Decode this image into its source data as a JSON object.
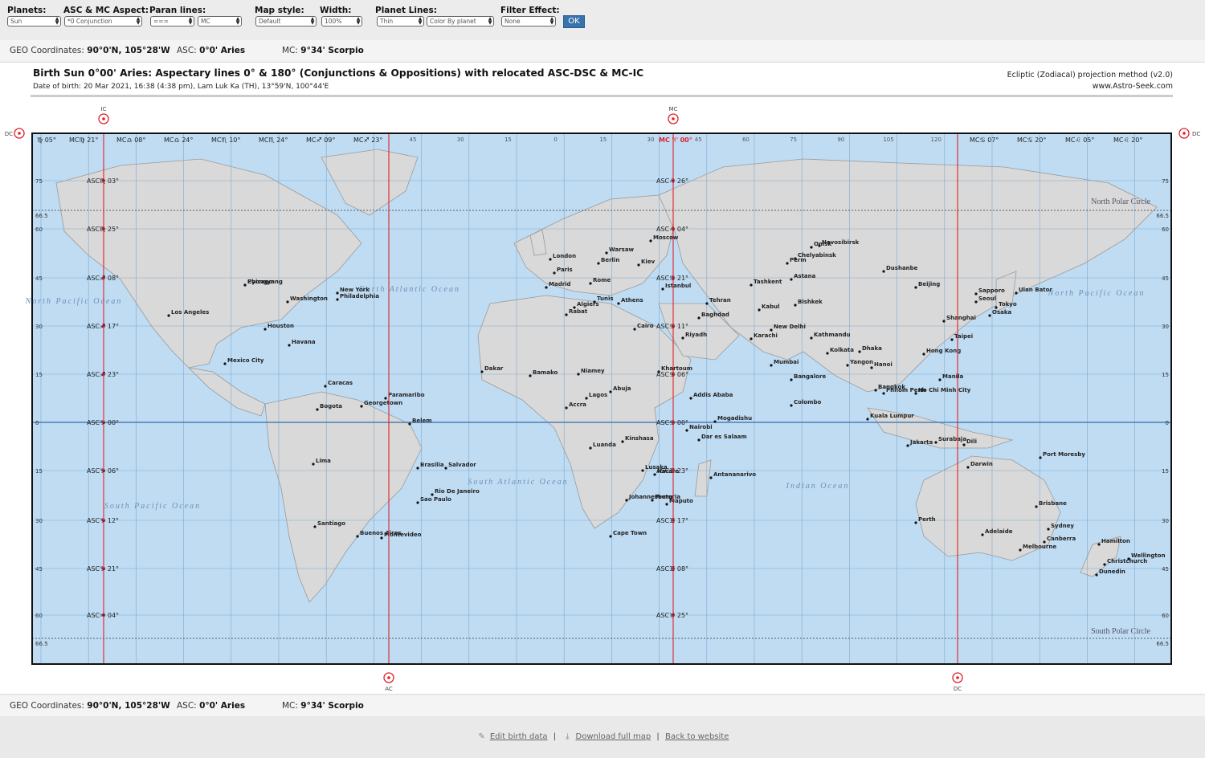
{
  "controls": {
    "planets": {
      "label": "Planets:",
      "value": "Sun"
    },
    "aspect": {
      "label": "ASC & MC Aspect:",
      "value": "*0 Conjunction"
    },
    "paran": {
      "label": "Paran lines:",
      "value1": "===",
      "value2": "MC"
    },
    "map_style": {
      "label": "Map style:",
      "value": "Default"
    },
    "width": {
      "label": "Width:",
      "value": "100%"
    },
    "planet_lines": {
      "label": "Planet Lines:",
      "value1": "Thin",
      "value2": "Color By planet"
    },
    "filter": {
      "label": "Filter Effect:",
      "value": "None"
    },
    "ok_label": "OK"
  },
  "geo": {
    "coords_label": "GEO Coordinates:",
    "coords_value": "90°0'N, 105°28'W",
    "asc_label": "ASC:",
    "asc_value": "0°0' Aries",
    "mc_label": "MC:",
    "mc_value": "9°34' Scorpio"
  },
  "map": {
    "title": "Birth Sun 0°00' Aries:  Aspectary lines 0° & 180° (Conjunctions & Oppositions) with relocated ASC-DSC & MC-IC",
    "subtitle": "Date of birth: 20 Mar 2021, 16:38 (4:38 pm), Lam Luk Ka (TH), 13°59'N, 100°44'E",
    "method": "Ecliptic (Zodiacal) projection method (v2.0)",
    "site": "www.Astro-Seek.com",
    "line_labels": {
      "ic": "IC",
      "mc": "MC",
      "ac": "AC",
      "dc": "DC"
    },
    "lat_labels": [
      "75",
      "60",
      "45",
      "30",
      "15",
      "0",
      "15",
      "30",
      "45",
      "60"
    ],
    "polar_value": "66.5",
    "lon_labels": [
      "45",
      "30",
      "15",
      "0",
      "15",
      "30",
      "45",
      "60",
      "75",
      "90",
      "105",
      "120"
    ],
    "north_polar_circle": "North Polar Circle",
    "south_polar_circle": "South Polar Circle",
    "top_signs_left": [
      "♍ 05°",
      "MC♍ 21°",
      "MC♎ 08°",
      "MC♎ 24°",
      "MC♏ 10°",
      "MC♏ 24°",
      "MC♐ 09°",
      "MC♐ 23°"
    ],
    "top_sign_center": "MC ♈ 00°",
    "top_signs_right": [
      "MC♋ 07°",
      "MC♋ 20°",
      "MC♌ 05°",
      "MC♌ 20°"
    ],
    "asc_left": [
      "ASC♏ 03°",
      "ASC♏ 25°",
      "ASC♐ 08°",
      "ASC♐ 17°",
      "ASC♐ 23°",
      "ASC♑ 00°",
      "ASC♑ 06°",
      "ASC♑ 12°",
      "ASC♑ 21°",
      "ASC♒ 04°"
    ],
    "asc_mid": [
      "ASC♌ 26°",
      "ASC♌ 04°",
      "ASC♋ 21°",
      "ASC♋ 11°",
      "ASC♋ 06°",
      "ASC♋ 00°",
      "ASC♊ 23°",
      "ASC♊ 17°",
      "ASC♊ 08°",
      "ASC♉ 25°"
    ],
    "oceans": [
      "North Pacific Ocean",
      "North Atlantic Ocean",
      "North Pacific Ocean",
      "South Pacific Ocean",
      "South Atlantic Ocean",
      "Indian Ocean"
    ],
    "cities": [
      "Chicago",
      "New York",
      "Philadelphia",
      "Washington",
      "Los Angeles",
      "Houston",
      "Mexico City",
      "Havana",
      "Caracas",
      "Bogota",
      "Lima",
      "Santiago",
      "Buenos Aires",
      "Montevideo",
      "Sao Paulo",
      "Rio De Janeiro",
      "Brasilia",
      "Belem",
      "Salvador",
      "Paramaribo",
      "Georgetown",
      "London",
      "Paris",
      "Berlin",
      "Madrid",
      "Rome",
      "Moscow",
      "Warsaw",
      "Kiev",
      "Istanbul",
      "Athens",
      "Cairo",
      "Baghdad",
      "Tehran",
      "Riyadh",
      "Algiers",
      "Tunis",
      "Rabat",
      "Dakar",
      "Bamako",
      "Niamey",
      "Lagos",
      "Abuja",
      "Accra",
      "Khartoum",
      "Addis Ababa",
      "Nairobi",
      "Kinshasa",
      "Luanda",
      "Lusaka",
      "Harare",
      "Mogadishu",
      "Dar es Salaam",
      "Antananarivo",
      "Johannesburg",
      "Pretoria",
      "Maputo",
      "Cape Town",
      "Tashkent",
      "Kabul",
      "Karachi",
      "New Delhi",
      "Mumbai",
      "Kolkata",
      "Dhaka",
      "Bangalore",
      "Colombo",
      "Kathmandu",
      "Beijing",
      "Shanghai",
      "Seoul",
      "Tokyo",
      "Osaka",
      "Hong Kong",
      "Taipei",
      "Manila",
      "Bangkok",
      "Hanoi",
      "Yangon",
      "Phnom Penh",
      "Ho Chi Minh City",
      "Kuala Lumpur",
      "Jakarta",
      "Surabaja",
      "Dili",
      "Port Moresby",
      "Darwin",
      "Perth",
      "Adelaide",
      "Melbourne",
      "Sydney",
      "Canberra",
      "Brisbane",
      "Hamilton",
      "Wellington",
      "Dunedin",
      "Christchurch",
      "Novosibirsk",
      "Omsk",
      "Chelyabinsk",
      "Perm",
      "Astana",
      "Bishkek",
      "Dushanbe",
      "Ulan Bator",
      "Sapporo",
      "Pyongyang"
    ]
  },
  "footer": {
    "edit_label": "Edit birth data",
    "download_label": "Download full map",
    "back_label": "Back to website"
  },
  "colors": {
    "ocean": "#bfdcf3",
    "land": "#d9d9d9",
    "line_red": "#e0202a",
    "ok_button": "#3a72ad"
  }
}
